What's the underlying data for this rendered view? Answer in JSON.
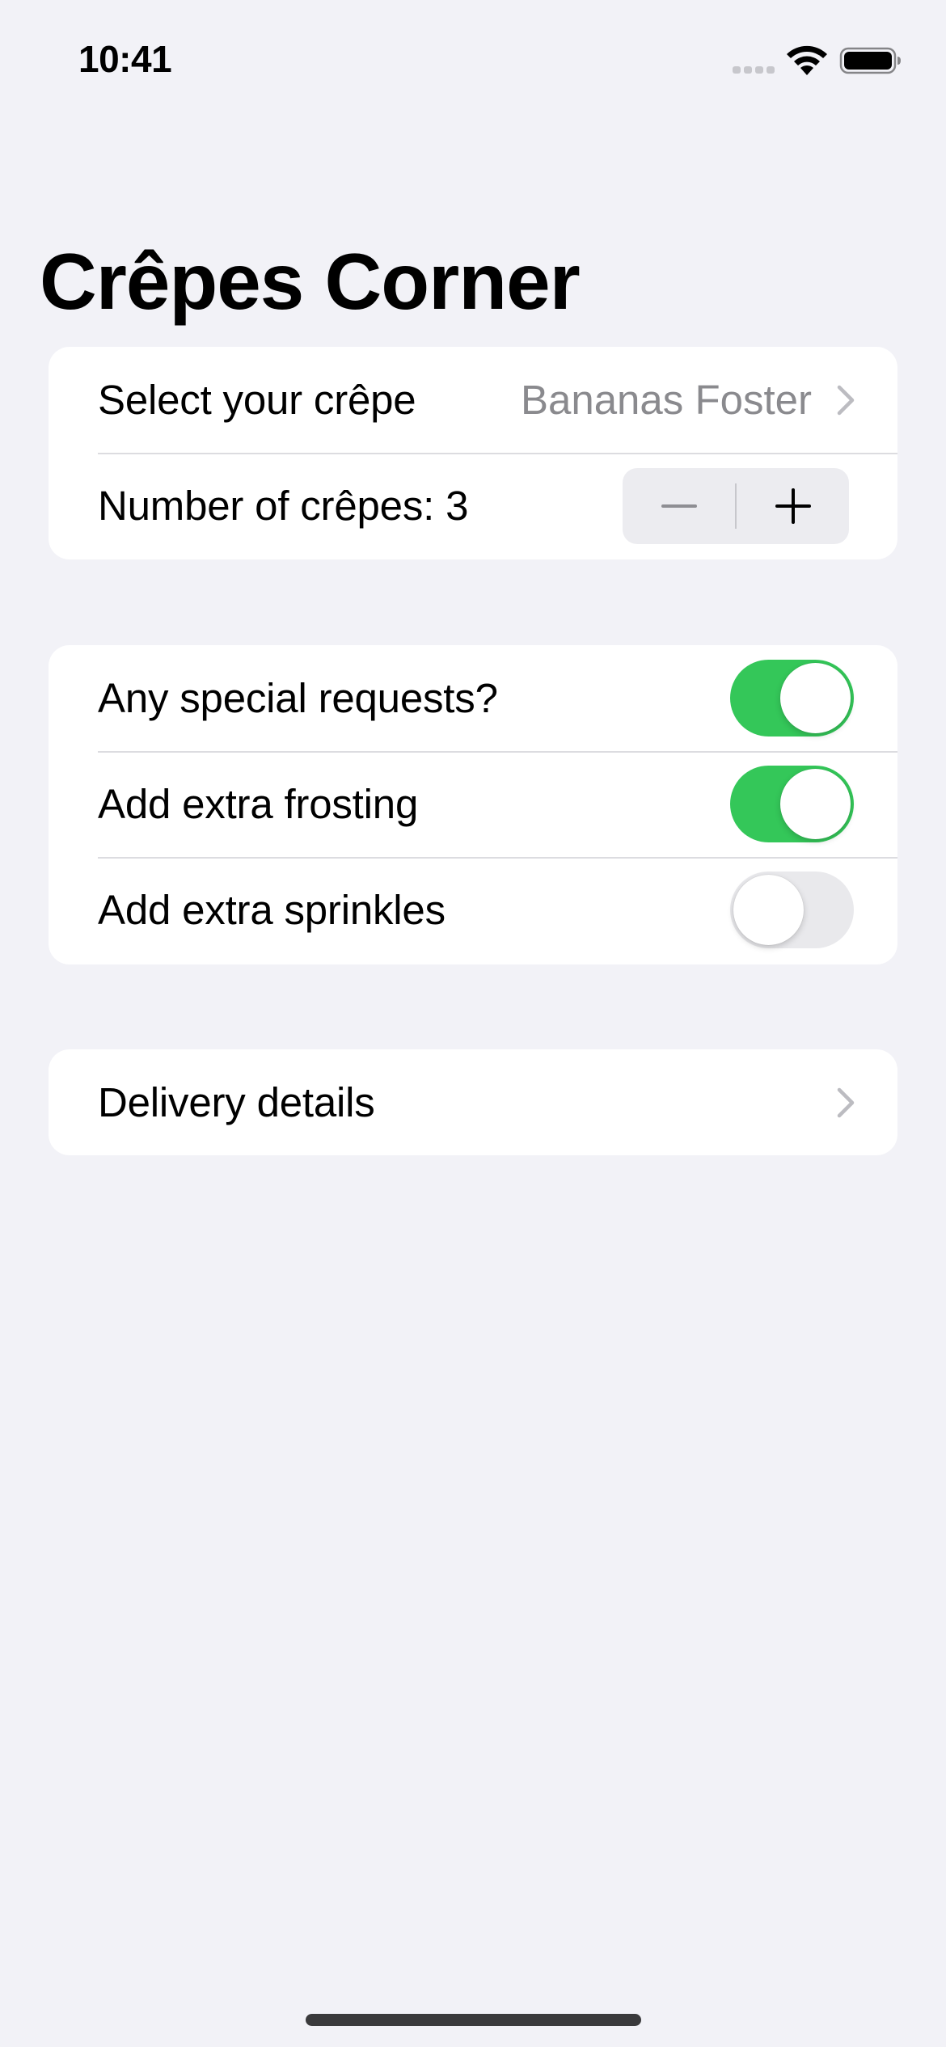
{
  "status_bar": {
    "time": "10:41"
  },
  "nav": {
    "title": "Crêpes Corner"
  },
  "order_section": {
    "crepe_label": "Select your crêpe",
    "crepe_value": "Bananas Foster",
    "count_label": "Number of crêpes: 3",
    "count_value": 3
  },
  "extras_section": {
    "items": [
      {
        "label": "Any special requests?",
        "on": true
      },
      {
        "label": "Add extra frosting",
        "on": true
      },
      {
        "label": "Add extra sprinkles",
        "on": false
      }
    ]
  },
  "delivery_section": {
    "label": "Delivery details"
  },
  "colors": {
    "background": "#f2f2f7",
    "toggle_on": "#34c759",
    "secondary_text": "#8a8a8e"
  },
  "icons": {
    "status": [
      "cellular-signal-icon",
      "wifi-icon",
      "battery-icon"
    ],
    "disclosure": "chevron-right-icon",
    "stepper": [
      "minus-icon",
      "plus-icon"
    ]
  }
}
